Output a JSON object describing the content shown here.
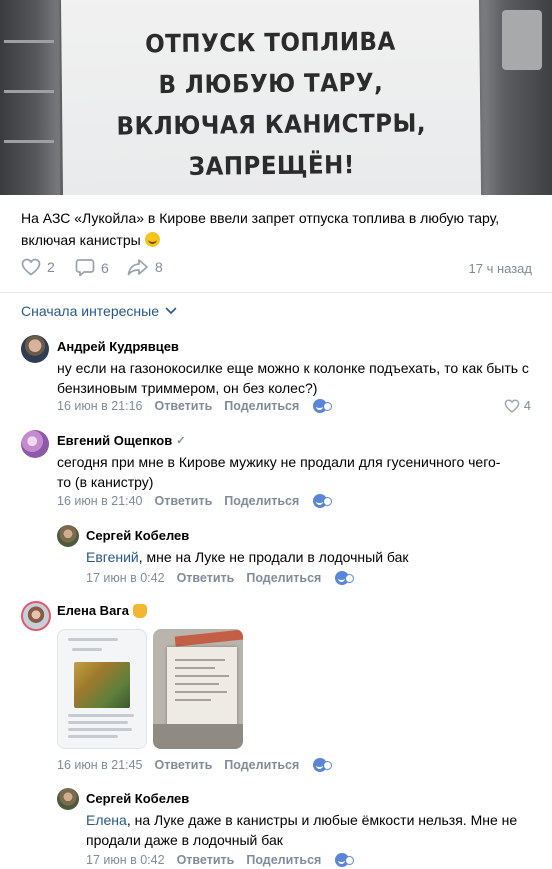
{
  "post": {
    "image_sign_lines": [
      "ОТПУСК ТОПЛИВА",
      "В ЛЮБУЮ ТАРУ,",
      "ВКЛЮЧАЯ КАНИСТРЫ,",
      "ЗАПРЕЩЁН!"
    ],
    "text": "На АЗС «Лукойла» в Кирове ввели запрет отпуска топлива в любую тару, включая канистры",
    "likes": "2",
    "comments": "6",
    "shares": "8",
    "time": "17 ч назад"
  },
  "sort_label": "Сначала интересные",
  "comments": [
    {
      "author": "Андрей Кудрявцев",
      "text": "ну если на газонокосилке еще можно к колонке подъехать, то как быть с бензиновым триммером, он без колес?)",
      "date": "16 июн в 21:16",
      "reply": "Ответить",
      "share": "Поделиться",
      "likes": "4"
    },
    {
      "author": "Евгений Ощепков",
      "verified_mark": "✓",
      "text": "сегодня при мне в Кирове мужику не продали для гусеничного чего-то (в канистру)",
      "date": "16 июн в 21:40",
      "reply": "Ответить",
      "share": "Поделиться"
    },
    {
      "author": "Сергей Кобелев",
      "mention": "Евгений",
      "text": ", мне на Луке не продали в лодочный бак",
      "date": "17 июн в 0:42",
      "reply": "Ответить",
      "share": "Поделиться"
    },
    {
      "author": "Елена Вага",
      "date": "16 июн в 21:45",
      "reply": "Ответить",
      "share": "Поделиться"
    },
    {
      "author": "Сергей Кобелев",
      "mention": "Елена",
      "text_line1": ", на Луке даже в канистры и любые ёмкости нельзя. Мне не",
      "text_line2": "продали даже в лодочный бак",
      "date": "17 июн в 0:42",
      "reply": "Ответить",
      "share": "Поделиться"
    }
  ],
  "colors": {
    "link": "#2a5885",
    "muted": "#818c99",
    "divider": "#e7e8ec",
    "reaction_blue": "#5a86d8"
  },
  "icons": [
    "heart-icon",
    "comment-icon",
    "share-icon",
    "chevron-down-icon",
    "reaction-icon",
    "verified-icon",
    "ok-hand-emoji",
    "grinning-emoji"
  ]
}
